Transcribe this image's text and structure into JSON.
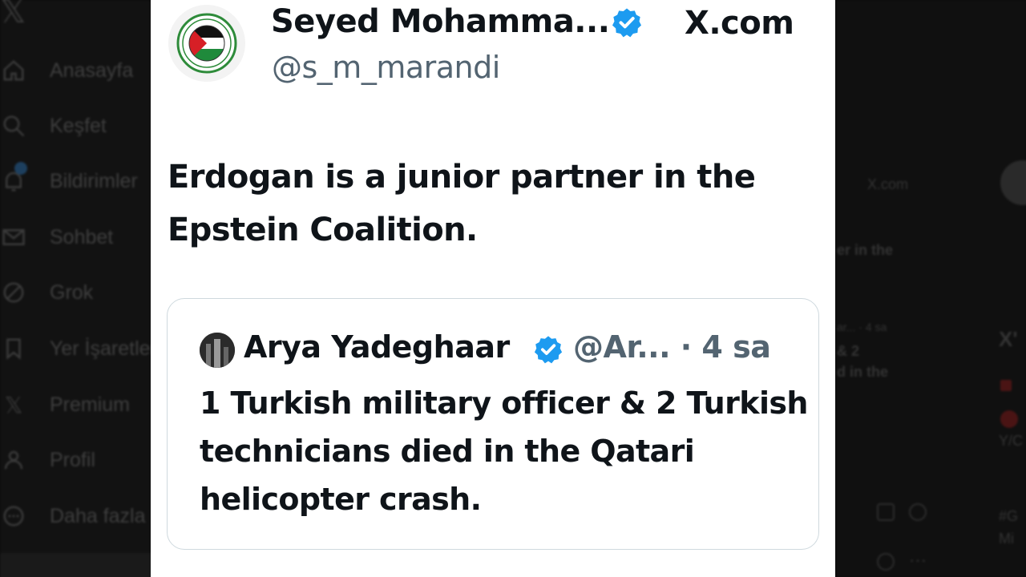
{
  "background_sidebar": {
    "logo_icon": "x-logo-icon",
    "items": [
      {
        "icon": "home-icon",
        "label": "Anasayfa"
      },
      {
        "icon": "search-icon",
        "label": "Keşfet"
      },
      {
        "icon": "bell-icon",
        "label": "Bildirimler"
      },
      {
        "icon": "mail-icon",
        "label": "Sohbet"
      },
      {
        "icon": "grok-icon",
        "label": "Grok"
      },
      {
        "icon": "bookmark-icon",
        "label": "Yer İşaretleri"
      },
      {
        "icon": "x-logo-icon",
        "label": "Premium"
      },
      {
        "icon": "person-icon",
        "label": "Profil"
      },
      {
        "icon": "more-icon",
        "label": "Daha fazla"
      }
    ]
  },
  "background_right": {
    "xcom": "X.com",
    "snippet_1": "er in the",
    "snippet_2": "ar... · 4 sa",
    "snippet_3": "& 2",
    "snippet_4": "d in the",
    "side_title": "X'",
    "side_1": "Y/C",
    "side_2": "#G",
    "side_3": "Mi"
  },
  "tweet": {
    "author_name": "Seyed Mohamma...",
    "author_handle": "@s_m_marandi",
    "source": "X.com",
    "verified_color": "#1d9bf0",
    "text": "Erdogan is a junior partner in the Epstein Coalition.",
    "quote": {
      "author_name": "Arya Yadeghaar",
      "author_handle": "@Ar... · 4 sa",
      "text": "1 Turkish military officer & 2 Turkish technicians died in the Qatari helicopter crash."
    }
  }
}
